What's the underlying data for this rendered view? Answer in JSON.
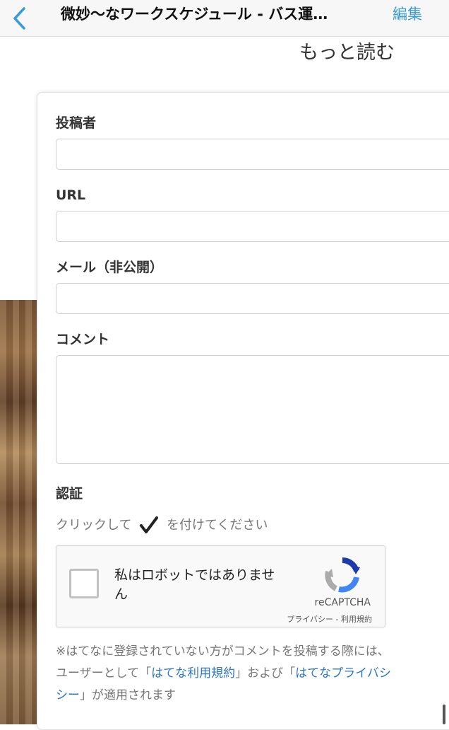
{
  "navbar": {
    "title": "微妙〜なワークスケジュール - バス運…",
    "edit_label": "編集"
  },
  "read_more": "もっと読む",
  "form": {
    "name_label": "投稿者",
    "url_label": "URL",
    "email_label": "メール（非公開）",
    "comment_label": "コメント",
    "name_value": "",
    "url_value": "",
    "email_value": "",
    "comment_value": "",
    "auth_label": "認証",
    "auth_hint_before": "クリックして",
    "auth_hint_after": "を付けてください"
  },
  "recaptcha": {
    "checkbox_text": "私はロボットではありません",
    "brand": "reCAPTCHA",
    "links": "プライバシー - 利用規約"
  },
  "notice": {
    "line1": "※はてなに登録されていない方がコメントを投稿する際には、",
    "line2_before": "ユーザーとして「",
    "terms_link": "はてな利用規約",
    "line2_middle": "」および「",
    "privacy_link_part1": "はてなプライバシ",
    "privacy_link_part2": "シー",
    "line3_after": "」が適用されます"
  },
  "colors": {
    "accent": "#3b9bd6",
    "link": "#2c78c4"
  }
}
